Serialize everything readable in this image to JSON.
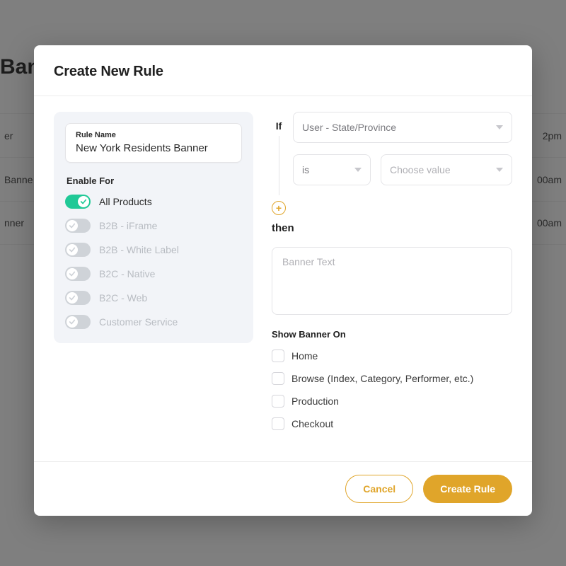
{
  "background": {
    "page_title": "Banner",
    "rows": [
      {
        "name": "er",
        "time": "2pm"
      },
      {
        "name": "Banne",
        "time": "00am"
      },
      {
        "name": "nner",
        "time": "00am"
      }
    ]
  },
  "modal": {
    "title": "Create New Rule",
    "rule_name_label": "Rule Name",
    "rule_name_value": "New York Residents Banner",
    "enable_for_label": "Enable For",
    "enable_for": [
      {
        "label": "All Products",
        "on": true
      },
      {
        "label": "B2B - iFrame",
        "on": false
      },
      {
        "label": "B2B - White Label",
        "on": false
      },
      {
        "label": "B2C - Native",
        "on": false
      },
      {
        "label": "B2C - Web",
        "on": false
      },
      {
        "label": "Customer Service",
        "on": false
      }
    ],
    "if_label": "If",
    "then_label": "then",
    "condition_field": "User - State/Province",
    "condition_operator": "is",
    "condition_value_placeholder": "Choose value",
    "banner_text_placeholder": "Banner Text",
    "show_on_label": "Show Banner On",
    "show_on": [
      {
        "label": "Home"
      },
      {
        "label": "Browse (Index, Category, Performer, etc.)"
      },
      {
        "label": "Production"
      },
      {
        "label": "Checkout"
      }
    ],
    "cancel_label": "Cancel",
    "submit_label": "Create Rule"
  },
  "colors": {
    "accent": "#e0a52a",
    "toggle_on": "#20c997"
  }
}
